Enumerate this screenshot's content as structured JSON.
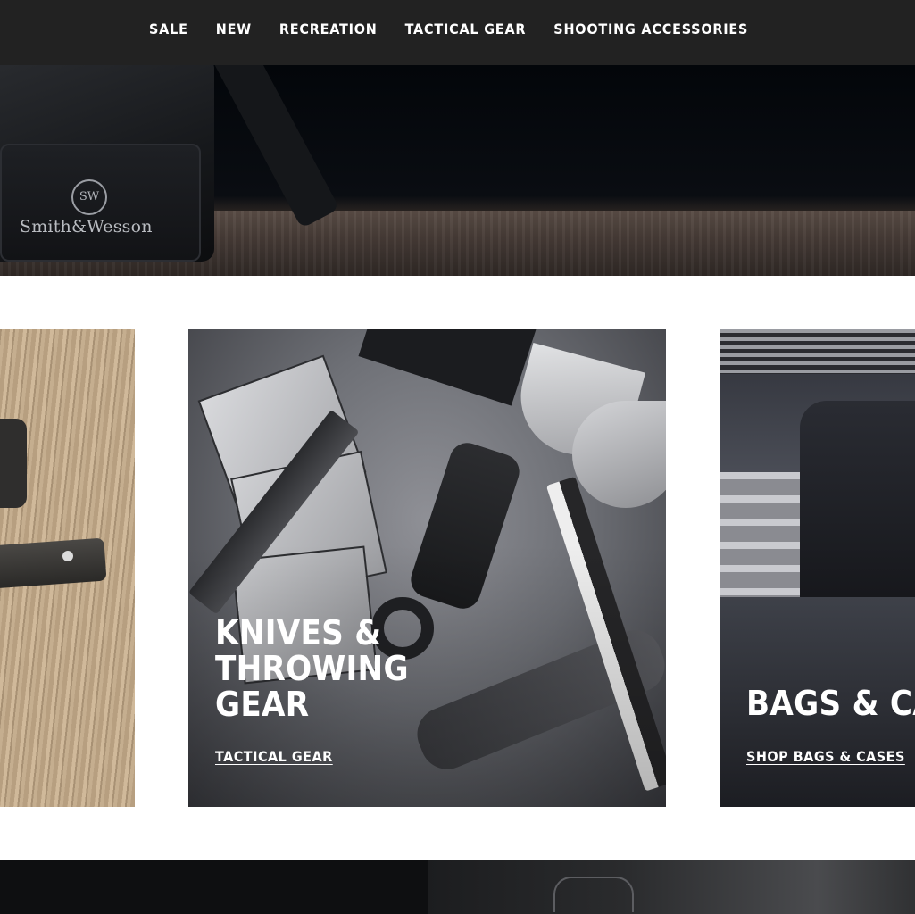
{
  "nav": {
    "items": [
      {
        "label": "SALE"
      },
      {
        "label": "NEW"
      },
      {
        "label": "RECREATION"
      },
      {
        "label": "TACTICAL GEAR"
      },
      {
        "label": "SHOOTING ACCESSORIES"
      }
    ]
  },
  "hero": {
    "brand_text": "Smith&Wesson",
    "brand_mark": "SW"
  },
  "cards": {
    "middle": {
      "title": "KNIVES &\nTHROWING\nGEAR",
      "link": "TACTICAL GEAR"
    },
    "right": {
      "title": "BAGS & CASES",
      "link": "SHOP BAGS & CASES"
    }
  },
  "colors": {
    "nav_bg": "#222222",
    "text_on_dark": "#ffffff",
    "page_bg": "#ffffff"
  }
}
